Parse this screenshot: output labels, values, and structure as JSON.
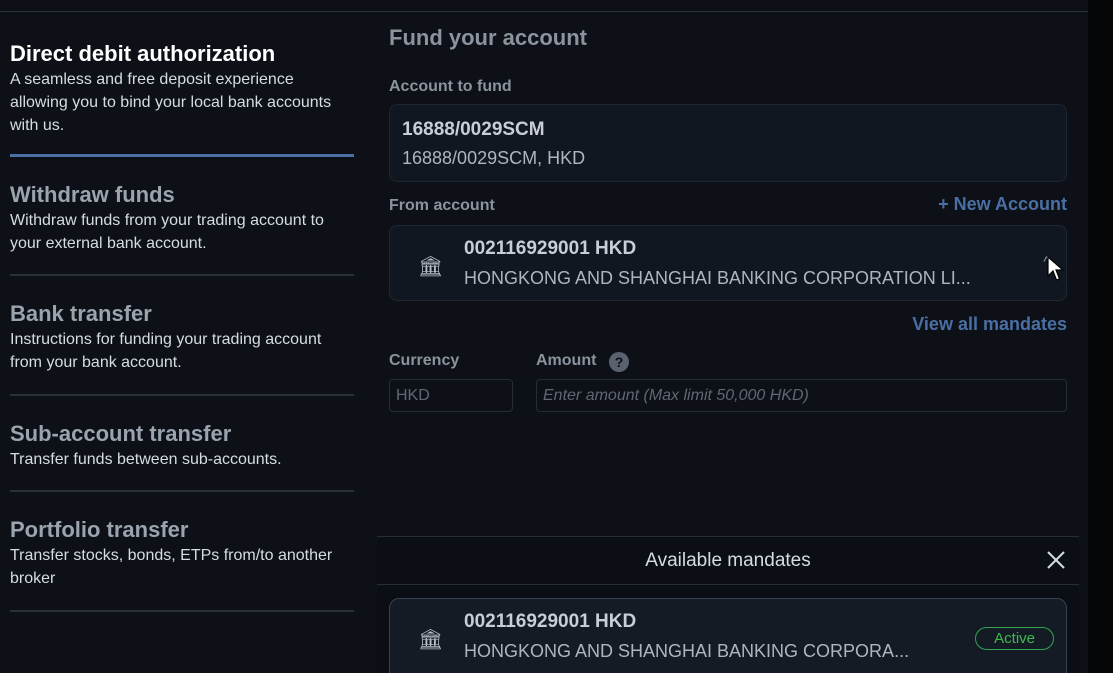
{
  "sidebar": {
    "items": [
      {
        "title": "Direct debit authorization",
        "description": "A seamless and free deposit experience allowing you to bind your local bank accounts with us.",
        "active": true
      },
      {
        "title": "Withdraw funds",
        "description": "Withdraw funds from your trading account to your external bank account.",
        "active": false
      },
      {
        "title": "Bank transfer",
        "description": "Instructions for funding your trading account from your bank account.",
        "active": false
      },
      {
        "title": "Sub-account transfer",
        "description": "Transfer funds between sub-accounts.",
        "active": false
      },
      {
        "title": "Portfolio transfer",
        "description": "Transfer stocks, bonds, ETPs from/to another broker",
        "active": false
      }
    ]
  },
  "main": {
    "title": "Fund your account",
    "account_to_fund": {
      "label": "Account to fund",
      "number": "16888/0029SCM",
      "subtitle": "16888/0029SCM, HKD"
    },
    "from_account": {
      "label": "From account",
      "new_account_label": "+ New Account",
      "number": "002116929001 HKD",
      "bank_name": "HONGKONG AND SHANGHAI BANKING CORPORATION LI...",
      "icon": "bank-icon"
    },
    "view_all_mandates_label": "View all mandates",
    "currency": {
      "label": "Currency",
      "value": "HKD"
    },
    "amount": {
      "label": "Amount",
      "placeholder": "Enter amount (Max limit 50,000 HKD)",
      "help_glyph": "?"
    }
  },
  "mandates_sheet": {
    "title": "Available mandates",
    "mandate": {
      "number": "002116929001 HKD",
      "bank_name": "HONGKONG AND SHANGHAI BANKING CORPORA...",
      "status": "Active",
      "status_color": "#3fb950"
    }
  },
  "colors": {
    "accent": "#4a6fa5",
    "background": "#0d1117"
  }
}
